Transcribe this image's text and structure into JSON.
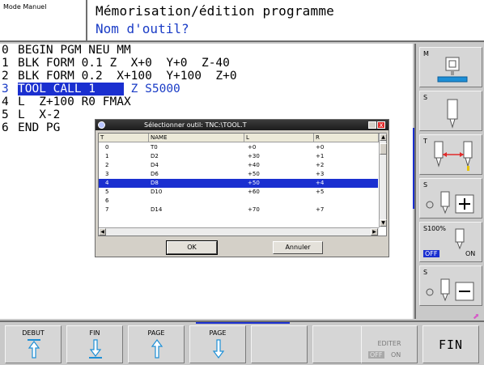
{
  "header": {
    "mode": "Mode Manuel",
    "title": "Mémorisation/édition programme",
    "subtitle": "Nom d'outil?"
  },
  "program": {
    "lines": [
      {
        "num": "0",
        "text": "BEGIN PGM NEU MM"
      },
      {
        "num": "1",
        "text": "BLK FORM 0.1 Z  X+0  Y+0  Z-40"
      },
      {
        "num": "2",
        "text": "BLK FORM 0.2  X+100  Y+100  Z+0"
      },
      {
        "num": "3",
        "text_hl": "TOOL CALL 1",
        "text_rest": " Z S5000"
      },
      {
        "num": "4",
        "text": "L  Z+100 R0 FMAX"
      },
      {
        "num": "5",
        "text": "L  X-2"
      },
      {
        "num": "6",
        "text": "END PG"
      }
    ]
  },
  "dialog": {
    "title": "Sélectionner outil: TNC:\\TOOL.T",
    "columns": [
      "T",
      "NAME",
      "L",
      "R"
    ],
    "rows": [
      [
        "0",
        "T0",
        "+0",
        "+0"
      ],
      [
        "1",
        "D2",
        "+30",
        "+1"
      ],
      [
        "2",
        "D4",
        "+40",
        "+2"
      ],
      [
        "3",
        "D6",
        "+50",
        "+3"
      ],
      [
        "4",
        "D8",
        "+50",
        "+4"
      ],
      [
        "5",
        "D10",
        "+60",
        "+5"
      ],
      [
        "6",
        "",
        "",
        ""
      ],
      [
        "7",
        "D14",
        "+70",
        "+7"
      ]
    ],
    "selected_index": 4,
    "ok_label": "OK",
    "cancel_label": "Annuler",
    "close_glyph": "x"
  },
  "right_softkeys": {
    "k1": "M",
    "k2": "S",
    "k3": "T",
    "k4": "S",
    "k5_label": "S100%",
    "k5_off": "OFF",
    "k5_on": "ON",
    "k6": "S"
  },
  "bottom_softkeys": {
    "debut": "DEBUT",
    "fin": "FIN",
    "page_up": "PAGE",
    "page_down": "PAGE",
    "editer": "EDITER",
    "editer_off": "OFF",
    "editer_on": "ON",
    "fin_big": "FIN"
  },
  "colors": {
    "accent_blue": "#1a2fd0",
    "text_blue": "#1a3cc6",
    "arrow_cyan": "#1d8fd6",
    "arrow_red": "#e02a2a"
  },
  "icons": [
    "machine-icon",
    "spindle-icon",
    "tool-length-icon",
    "plus-icon",
    "minus-icon",
    "arrow-up-icon",
    "arrow-down-icon",
    "page-up-icon",
    "page-down-icon",
    "close-icon"
  ]
}
